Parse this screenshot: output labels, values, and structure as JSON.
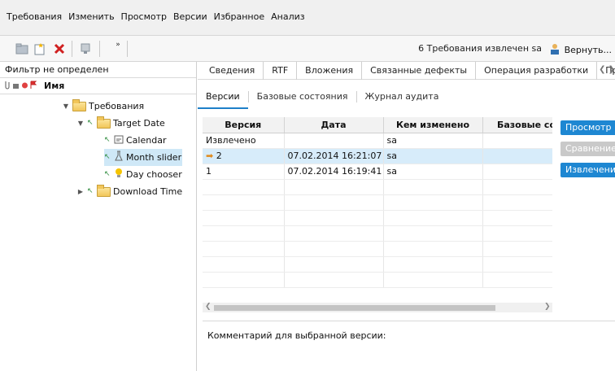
{
  "menu": [
    "Требования",
    "Изменить",
    "Просмотр",
    "Версии",
    "Избранное",
    "Анализ"
  ],
  "toolbar": {
    "status": "6 Требования извлечен sa",
    "revert": "Вернуть...",
    "icons": [
      "new-folder-icon",
      "new-requirement-icon",
      "delete-icon",
      "move-icon",
      "expand-icon"
    ]
  },
  "left": {
    "filter": "Фильтр не определен",
    "header": "Имя",
    "tree": [
      {
        "label": "Требования",
        "type": "folder"
      },
      {
        "label": "Target Date",
        "type": "folder"
      },
      {
        "label": "Calendar",
        "type": "req"
      },
      {
        "label": "Month slider",
        "type": "req"
      },
      {
        "label": "Day chooser",
        "type": "req"
      },
      {
        "label": "Download Time",
        "type": "folder"
      }
    ]
  },
  "right": {
    "tabs1": [
      "Сведения",
      "RTF",
      "Вложения",
      "Связанные дефекты",
      "Операция разработки",
      "Прс"
    ],
    "tabs2": [
      "Версии",
      "Базовые состояния",
      "Журнал аудита"
    ],
    "columns": [
      "Версия",
      "Дата",
      "Кем изменено",
      "Базовые со"
    ],
    "rows": [
      {
        "version": "Извлечено",
        "date": "",
        "by": "sa",
        "base": ""
      },
      {
        "version": "2",
        "date": "07.02.2014 16:21:07",
        "by": "sa",
        "base": ""
      },
      {
        "version": "1",
        "date": "07.02.2014 16:19:41",
        "by": "sa",
        "base": ""
      }
    ],
    "buttons": [
      "Просмотр",
      "Сравнение",
      "Извлечение"
    ],
    "comment_label": "Комментарий для выбранной версии:"
  },
  "colors": {
    "accent": "#1e87d2",
    "selection": "#d7ecfa",
    "disabled": "#c9c9c9"
  }
}
